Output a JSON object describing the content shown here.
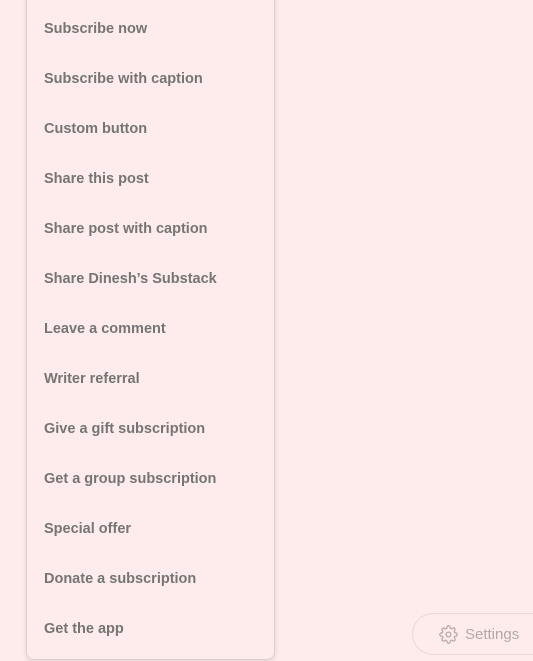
{
  "menu": {
    "items": [
      {
        "label": "Subscribe now"
      },
      {
        "label": "Subscribe with caption"
      },
      {
        "label": "Custom button"
      },
      {
        "label": "Share this post"
      },
      {
        "label": "Share post with caption"
      },
      {
        "label": "Share Dinesh’s Substack"
      },
      {
        "label": "Leave a comment"
      },
      {
        "label": "Writer referral"
      },
      {
        "label": "Give a gift subscription"
      },
      {
        "label": "Get a group subscription"
      },
      {
        "label": "Special offer"
      },
      {
        "label": "Donate a subscription"
      },
      {
        "label": "Get the app"
      }
    ]
  },
  "settings": {
    "label": "Settings",
    "icon": "gear-icon"
  },
  "colors": {
    "background": "#fdeceb",
    "menu_text": "#757575",
    "settings_text": "#b3a9a8"
  }
}
